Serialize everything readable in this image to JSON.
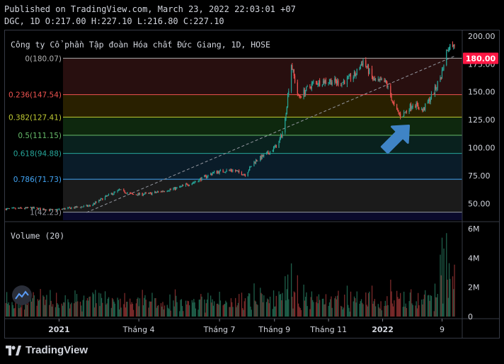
{
  "header": {
    "published": "Published on TradingView.com, March 23, 2022 22:03:01 +07",
    "ohlc": "DGC, 1D O:217.00 H:227.10 L:216.80 C:227.10"
  },
  "brand": {
    "name": "TradingView"
  },
  "colors": {
    "up": "#26a69a",
    "down": "#ef5350",
    "last_price_bg": "#ff1744",
    "arrow": "#3f84c6",
    "trendline": "#9598a1"
  },
  "chart_data": {
    "type": "candlestick",
    "title": "Công ty Cổ phần Tập đoàn Hóa chất Đức Giang, 1D, HOSE",
    "last_price": "180.00",
    "price_axis": {
      "ylim": [
        35,
        205
      ],
      "ticks": [
        {
          "value": 50,
          "label": "50.00"
        },
        {
          "value": 75,
          "label": "75.00"
        },
        {
          "value": 100,
          "label": "100.00"
        },
        {
          "value": 125,
          "label": "125.00"
        },
        {
          "value": 150,
          "label": "150.00"
        },
        {
          "value": 175,
          "label": "175.00"
        },
        {
          "value": 200,
          "label": "200.00"
        }
      ]
    },
    "fibonacci": [
      {
        "value": 180.07,
        "label": "0(180.07)",
        "color": "#b0b0b0",
        "fill": "#2a1010"
      },
      {
        "value": 147.54,
        "label": "0.236(147.54)",
        "color": "#ef5350",
        "fill": "#2b2200"
      },
      {
        "value": 127.41,
        "label": "0.382(127.41)",
        "color": "#c0ca33",
        "fill": "#0f2a0f"
      },
      {
        "value": 111.15,
        "label": "0.5(111.15)",
        "color": "#66bb6a",
        "fill": "#0a2320"
      },
      {
        "value": 94.88,
        "label": "0.618(94.88)",
        "color": "#26a69a",
        "fill": "#0b1d2b"
      },
      {
        "value": 71.73,
        "label": "0.786(71.73)",
        "color": "#42a5f5",
        "fill": "#1c1c1c"
      },
      {
        "value": 42.23,
        "label": "1(42.23)",
        "color": "#9598a1",
        "fill": "#0b0b2e"
      }
    ],
    "time_axis": {
      "ticks": [
        {
          "label": "2021",
          "date": "2021-01-01",
          "bold": true
        },
        {
          "label": "Tháng 4",
          "date": "2021-04-01",
          "bold": false
        },
        {
          "label": "Tháng 7",
          "date": "2021-07-01",
          "bold": false
        },
        {
          "label": "Tháng 9",
          "date": "2021-09-01",
          "bold": false
        },
        {
          "label": "Tháng 11",
          "date": "2021-11-01",
          "bold": false
        },
        {
          "label": "2022",
          "date": "2022-01-01",
          "bold": true
        },
        {
          "label": "9",
          "date": "2022-03-09",
          "bold": false
        }
      ]
    },
    "price_path": [
      [
        "2020-11-01",
        45
      ],
      [
        "2020-12-01",
        46
      ],
      [
        "2020-12-25",
        44
      ],
      [
        "2021-01-15",
        46
      ],
      [
        "2021-02-05",
        48
      ],
      [
        "2021-02-25",
        57
      ],
      [
        "2021-03-10",
        62
      ],
      [
        "2021-03-25",
        58
      ],
      [
        "2021-04-15",
        59
      ],
      [
        "2021-05-15",
        64
      ],
      [
        "2021-06-05",
        70
      ],
      [
        "2021-06-25",
        78
      ],
      [
        "2021-07-15",
        80
      ],
      [
        "2021-07-30",
        76
      ],
      [
        "2021-08-10",
        88
      ],
      [
        "2021-08-25",
        95
      ],
      [
        "2021-09-05",
        103
      ],
      [
        "2021-09-12",
        118
      ],
      [
        "2021-09-20",
        175
      ],
      [
        "2021-09-28",
        145
      ],
      [
        "2021-10-15",
        158
      ],
      [
        "2021-11-01",
        160
      ],
      [
        "2021-11-15",
        158
      ],
      [
        "2021-12-01",
        165
      ],
      [
        "2021-12-10",
        178
      ],
      [
        "2021-12-22",
        160
      ],
      [
        "2022-01-05",
        158
      ],
      [
        "2022-01-15",
        135
      ],
      [
        "2022-01-22",
        128
      ],
      [
        "2022-02-05",
        140
      ],
      [
        "2022-02-15",
        133
      ],
      [
        "2022-02-28",
        150
      ],
      [
        "2022-03-08",
        165
      ],
      [
        "2022-03-15",
        190
      ],
      [
        "2022-03-23",
        192
      ]
    ],
    "trendline": {
      "from": [
        "2021-02-01",
        42
      ],
      "to": [
        "2022-03-23",
        182
      ]
    },
    "volume": {
      "label": "Volume (20)",
      "ylim": [
        0,
        6000000
      ],
      "ticks": [
        {
          "value": 0,
          "label": "0"
        },
        {
          "value": 2000000,
          "label": "2M"
        },
        {
          "value": 4000000,
          "label": "4M"
        },
        {
          "value": 6000000,
          "label": "6M"
        }
      ]
    }
  }
}
